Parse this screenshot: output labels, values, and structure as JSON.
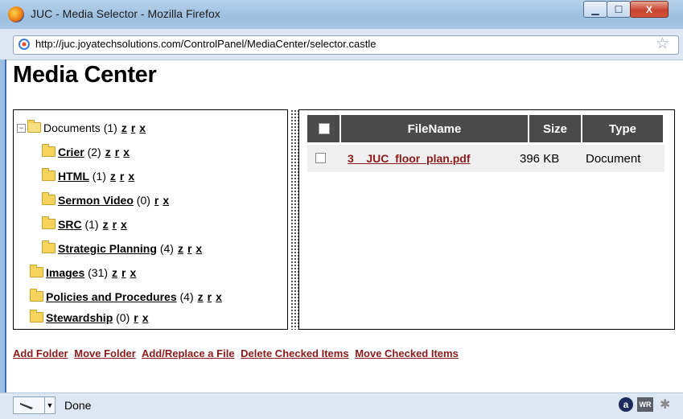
{
  "window": {
    "title": "JUC - Media Selector - Mozilla Firefox",
    "url": "http://juc.joyatechsolutions.com/ControlPanel/MediaCenter/selector.castle",
    "minimize_label": "▁",
    "maximize_label": "☐",
    "close_label": "X"
  },
  "page": {
    "title": "Media Center"
  },
  "tree": {
    "documents": {
      "expander": "−",
      "name": "Documents",
      "count": "(1)",
      "z": "z",
      "r": "r",
      "x": "x"
    },
    "crier": {
      "name": "Crier",
      "count": "(2)",
      "z": "z",
      "r": "r",
      "x": "x"
    },
    "html": {
      "name": "HTML",
      "count": "(1)",
      "z": "z",
      "r": "r",
      "x": "x"
    },
    "sermon_video": {
      "name": "Sermon Video",
      "count": "(0)",
      "r": "r",
      "x": "x"
    },
    "src": {
      "name": "SRC",
      "count": "(1)",
      "z": "z",
      "r": "r",
      "x": "x"
    },
    "strategic_planning": {
      "name": "Strategic Planning",
      "count": "(4)",
      "z": "z",
      "r": "r",
      "x": "x"
    },
    "images": {
      "name": "Images",
      "count": "(31)",
      "z": "z",
      "r": "r",
      "x": "x"
    },
    "policies": {
      "name": "Policies and Procedures",
      "count": "(4)",
      "z": "z",
      "r": "r",
      "x": "x"
    },
    "stewardship": {
      "name": "Stewardship",
      "count": "(0)",
      "r": "r",
      "x": "x"
    }
  },
  "files": {
    "columns": {
      "filename": "FileName",
      "size": "Size",
      "type": "Type"
    },
    "rows": [
      {
        "name": "3__JUC_floor_plan.pdf",
        "size": "396 KB",
        "type": "Document",
        "checked": false
      }
    ]
  },
  "actions": {
    "add_folder": "Add Folder",
    "move_folder": "Move Folder",
    "add_replace_file": "Add/Replace a File",
    "delete_checked": "Delete Checked Items",
    "move_checked": "Move Checked Items"
  },
  "status": {
    "text": "Done",
    "addon1": "a",
    "addon2": "WR"
  }
}
